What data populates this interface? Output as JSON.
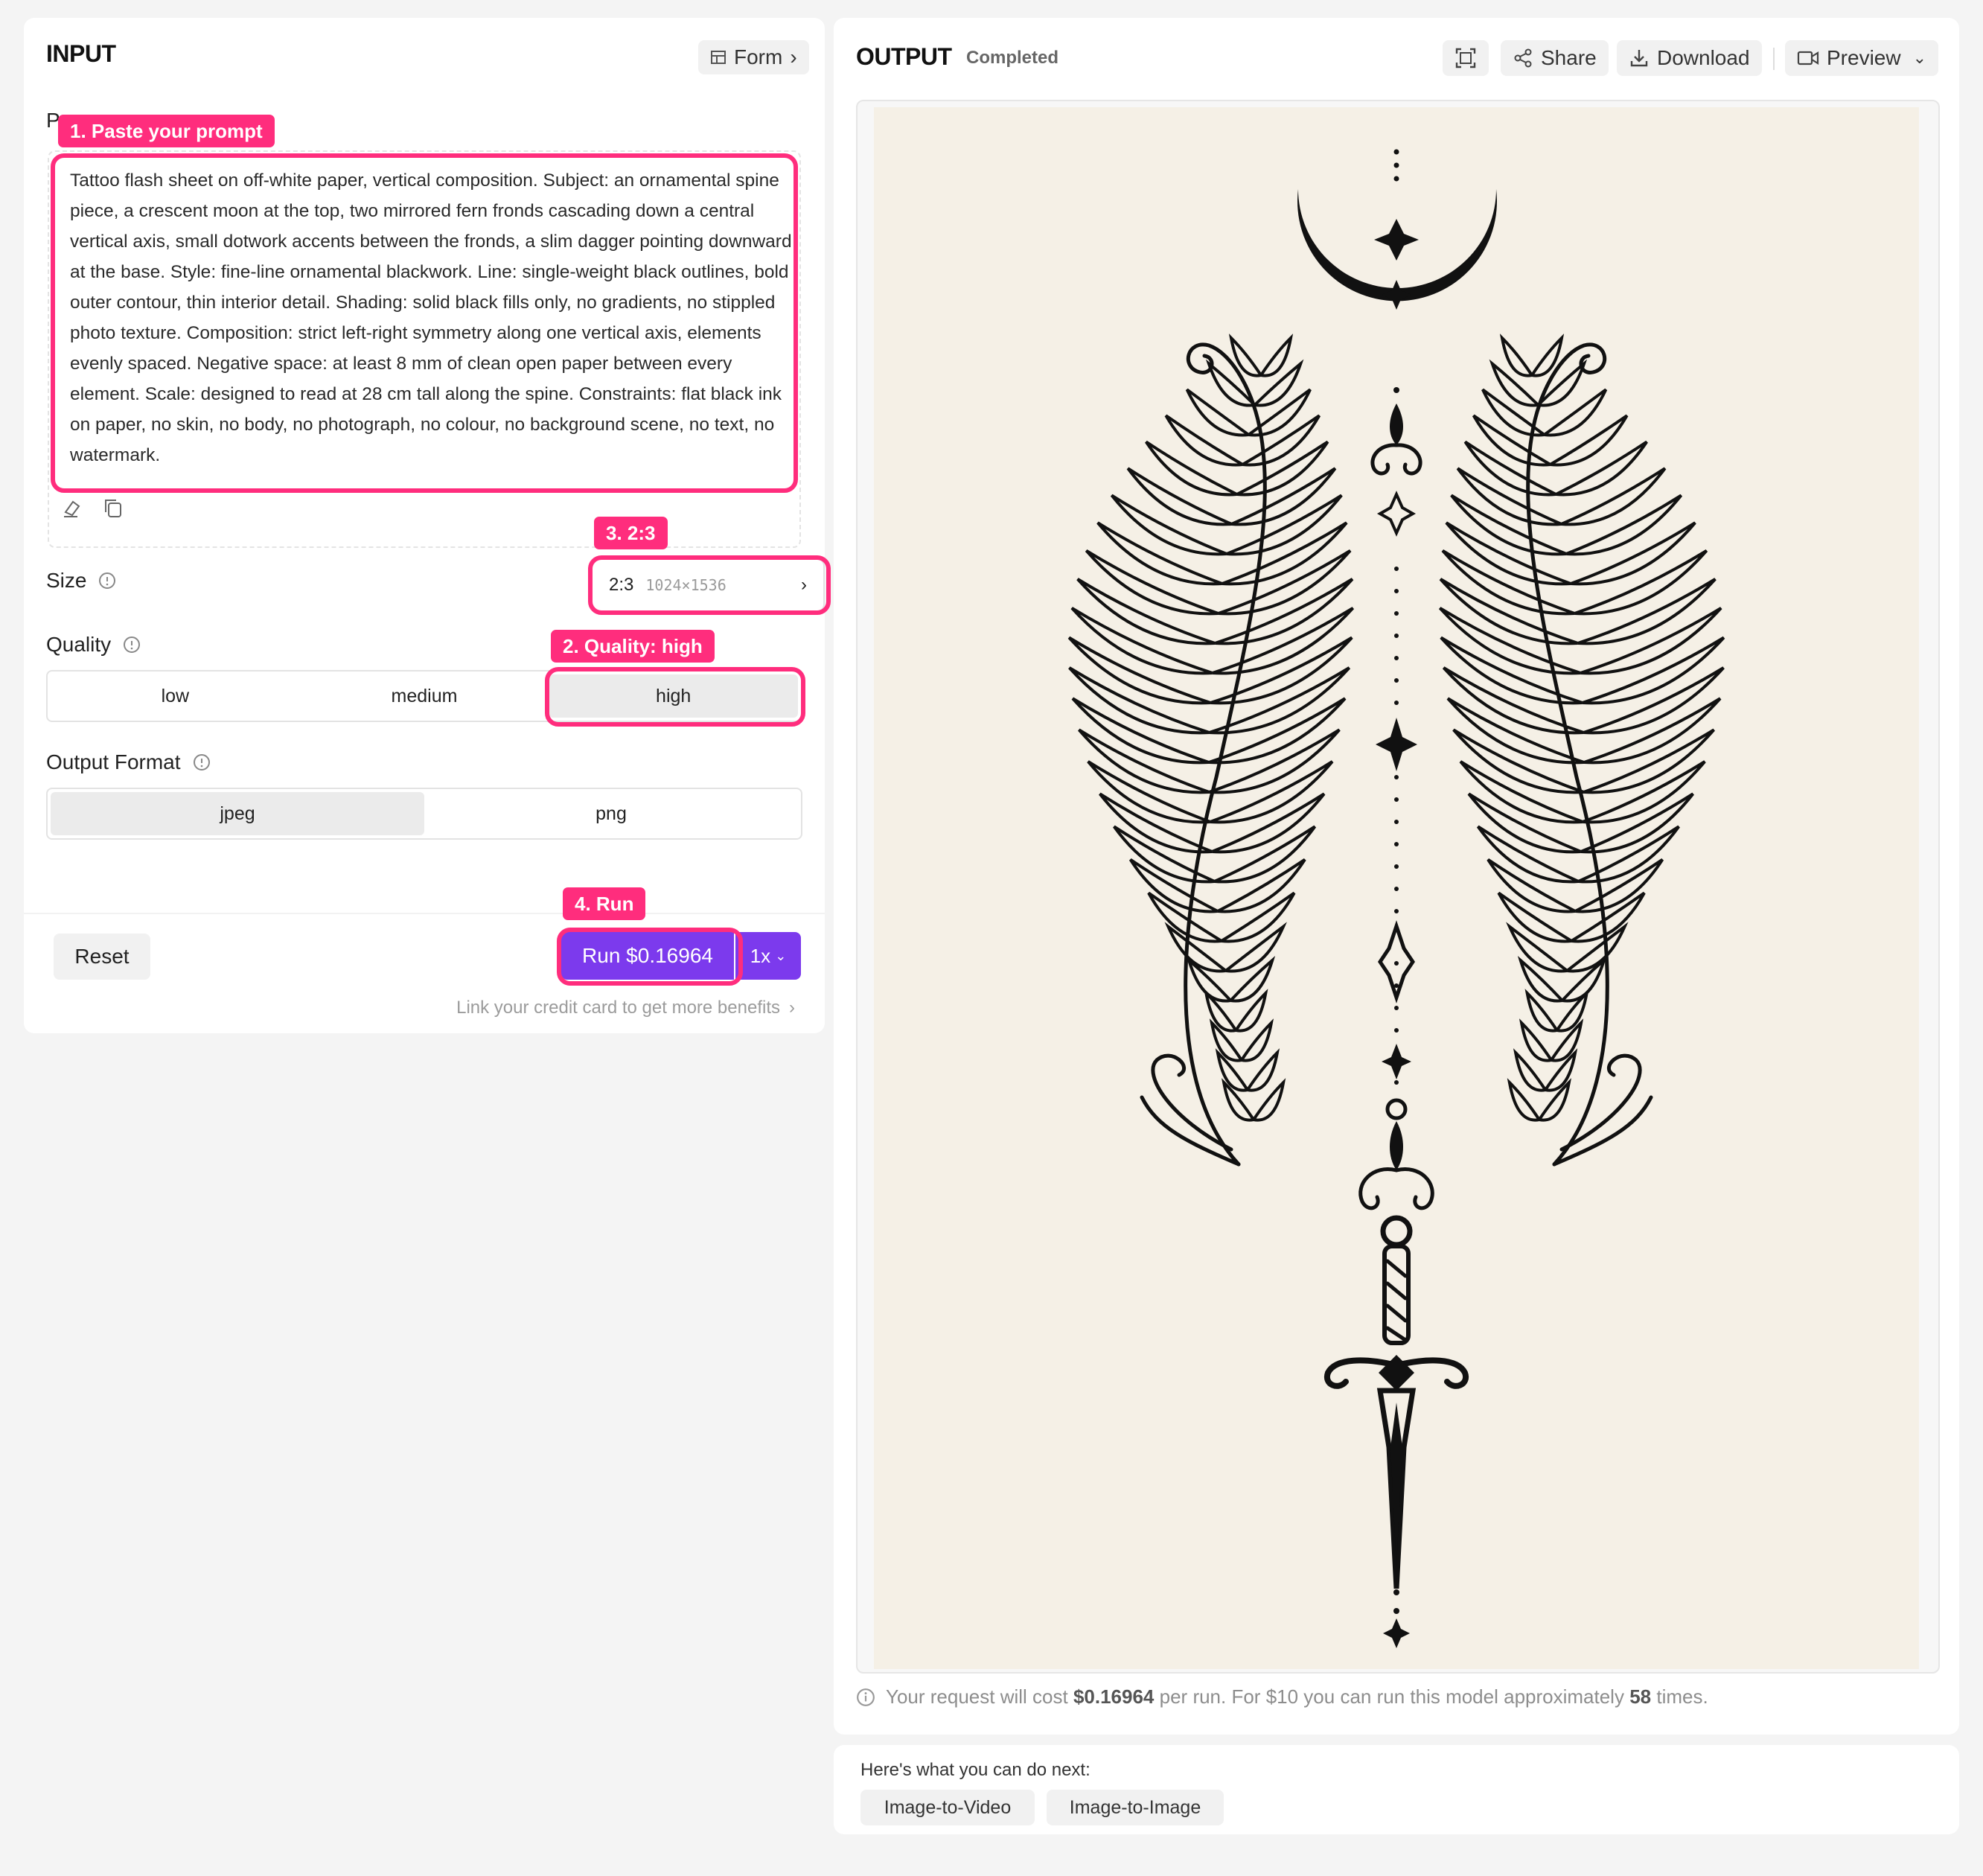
{
  "input": {
    "title": "INPUT",
    "form_label": "Form",
    "prompt_label_clip": "P",
    "prompt_text": "Tattoo flash sheet on off-white paper, vertical composition. Subject: an ornamental spine piece, a crescent moon at the top, two mirrored fern fronds cascading down a central vertical axis, small dotwork accents between the fronds, a slim dagger pointing downward at the base. Style: fine-line ornamental blackwork. Line: single-weight black outlines, bold outer contour, thin interior detail. Shading: solid black fills only, no gradients, no stippled photo texture. Composition: strict left-right symmetry along one vertical axis, elements evenly spaced. Negative space: at least 8 mm of clean open paper between every element. Scale: designed to read at 28 cm tall along the spine. Constraints: flat black ink on paper, no skin, no body, no photograph, no colour, no background scene, no text, no watermark.",
    "size": {
      "label": "Size",
      "ratio": "2:3",
      "dims": "1024×1536"
    },
    "quality": {
      "label": "Quality",
      "options": [
        "low",
        "medium",
        "high"
      ],
      "selected": "high"
    },
    "output_format": {
      "label": "Output Format",
      "options": [
        "jpeg",
        "png"
      ],
      "selected": "jpeg"
    },
    "reset_label": "Reset",
    "run_label": "Run $0.16964",
    "multiplier": "1x",
    "credit_link": "Link your credit card to get more benefits"
  },
  "annotations": {
    "step1": "1. Paste your prompt",
    "step2": "2. Quality: high",
    "step3": "3. 2:3",
    "step4": "4. Run"
  },
  "output": {
    "title": "OUTPUT",
    "status": "Completed",
    "share_label": "Share",
    "download_label": "Download",
    "preview_label": "Preview",
    "cost_prefix": "Your request will cost",
    "cost_value": "$0.16964",
    "cost_middle": "per run. For $10 you can run this model approximately",
    "cost_runs": "58",
    "cost_suffix": "times."
  },
  "next": {
    "title": "Here's what you can do next:",
    "actions": [
      "Image-to-Video",
      "Image-to-Image"
    ]
  },
  "colors": {
    "accent": "#7c3aed",
    "annotation": "#ff2d7d",
    "paper": "#f5f0e6"
  }
}
